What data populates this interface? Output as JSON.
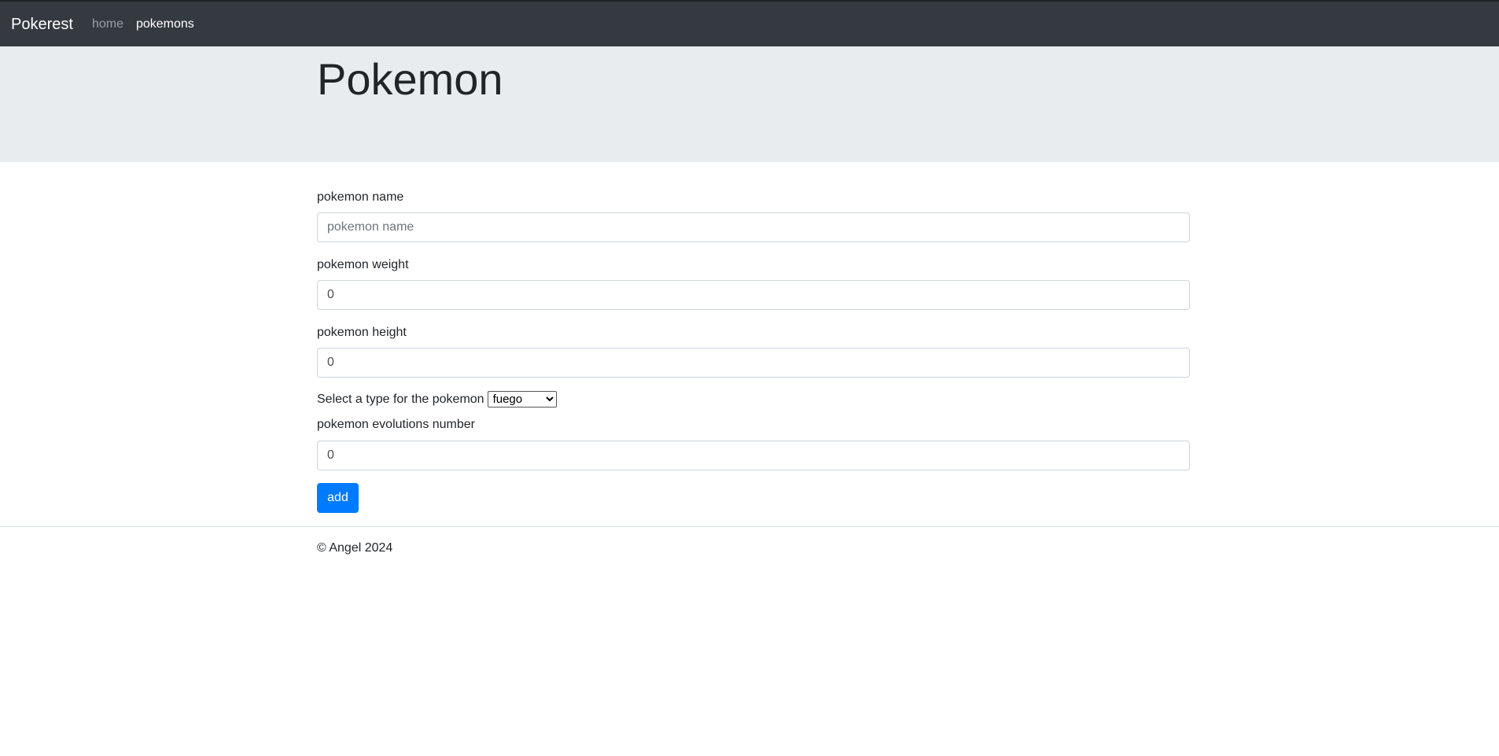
{
  "navbar": {
    "brand": "Pokerest",
    "links": [
      {
        "label": "home"
      },
      {
        "label": "pokemons"
      }
    ]
  },
  "header": {
    "title": "Pokemon"
  },
  "form": {
    "name": {
      "label": "pokemon name",
      "placeholder": "pokemon name",
      "value": ""
    },
    "weight": {
      "label": "pokemon weight",
      "value": "0"
    },
    "height": {
      "label": "pokemon height",
      "value": "0"
    },
    "type": {
      "label": "Select a type for the pokemon",
      "selected": "fuego"
    },
    "evolutions": {
      "label": "pokemon evolutions number",
      "value": "0"
    },
    "submit_label": "add"
  },
  "footer": {
    "text": "© Angel 2024"
  },
  "colors": {
    "navbar_bg": "#343a40",
    "jumbotron_bg": "#e9ecef",
    "primary": "#007bff"
  }
}
